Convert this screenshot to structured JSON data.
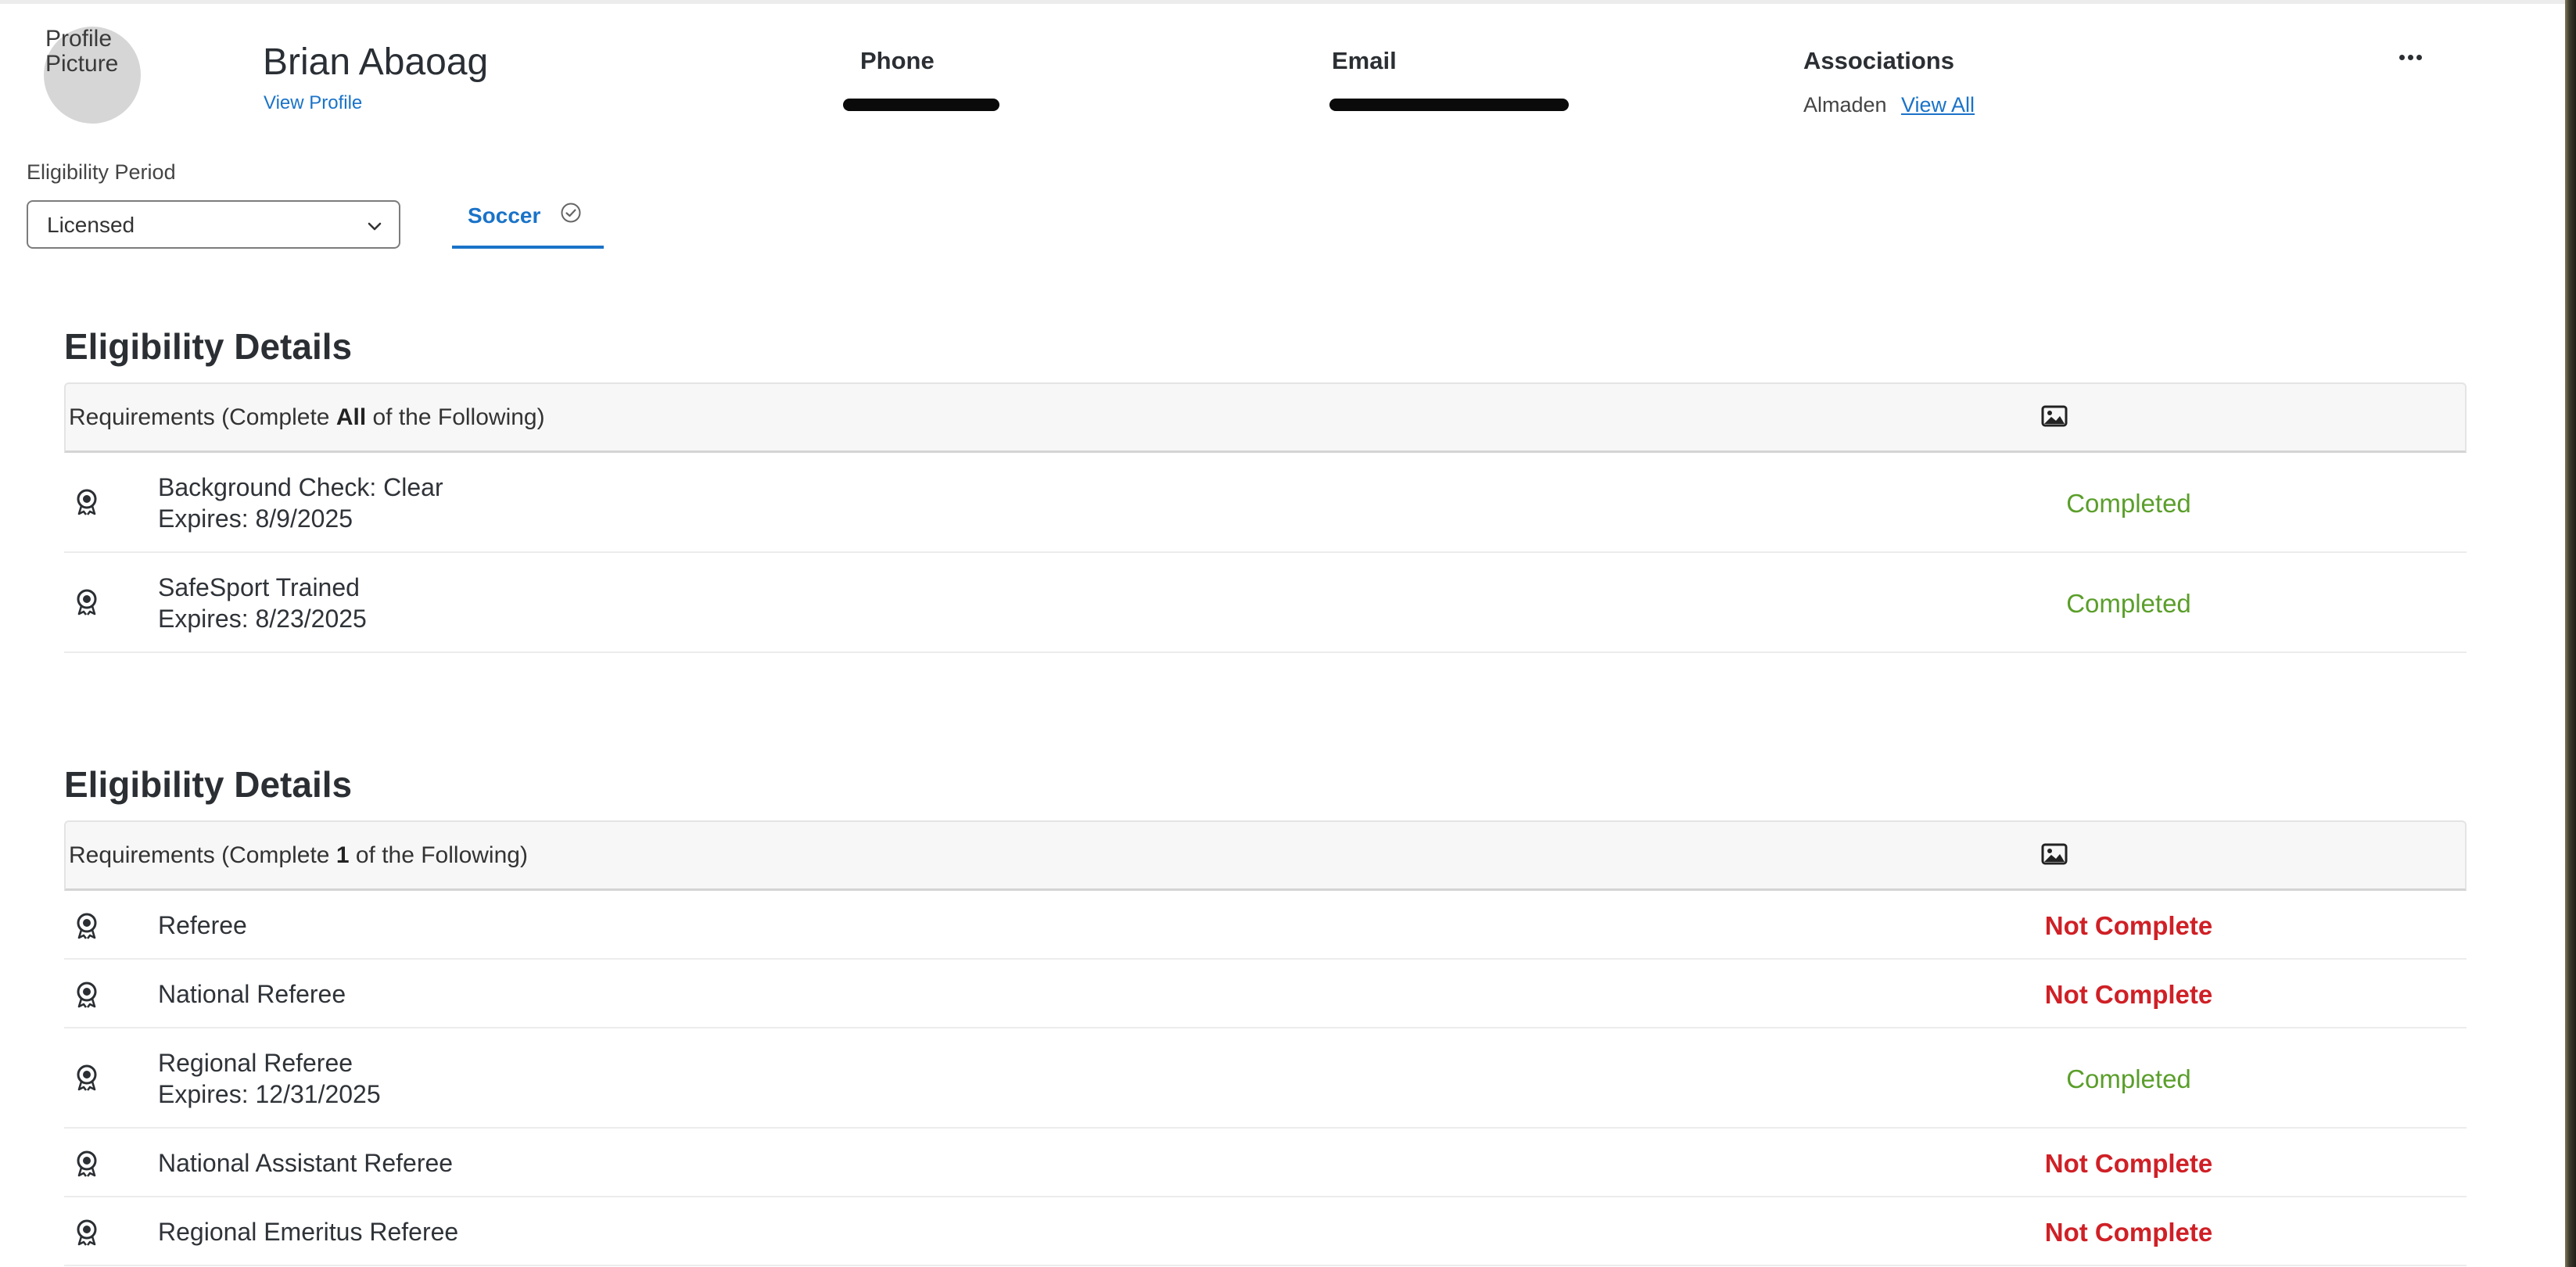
{
  "profile": {
    "avatar_text": "Profile Picture",
    "name": "Brian Abaoag",
    "view_profile": "View Profile"
  },
  "contact": {
    "phone_label": "Phone",
    "email_label": "Email",
    "associations_label": "Associations",
    "association_value": "Almaden",
    "associations_link": "View All"
  },
  "eligibility_period": {
    "label": "Eligibility Period",
    "selected": "Licensed"
  },
  "tab": {
    "label": "Soccer"
  },
  "sections": [
    {
      "title": "Eligibility Details",
      "requirements_prefix": "Requirements (Complete ",
      "requirements_count": "All",
      "requirements_suffix": " of the Following)",
      "rows": [
        {
          "title": "Background Check: Clear",
          "expires": "Expires: 8/9/2025",
          "status": "Completed"
        },
        {
          "title": "SafeSport Trained",
          "expires": "Expires: 8/23/2025",
          "status": "Completed"
        }
      ]
    },
    {
      "title": "Eligibility Details",
      "requirements_prefix": "Requirements (Complete ",
      "requirements_count": "1",
      "requirements_suffix": " of the Following)",
      "rows": [
        {
          "title": "Referee",
          "status": "Not Complete"
        },
        {
          "title": "National Referee",
          "status": "Not Complete"
        },
        {
          "title": "Regional Referee",
          "expires": "Expires: 12/31/2025",
          "status": "Completed"
        },
        {
          "title": "National Assistant Referee",
          "status": "Not Complete"
        },
        {
          "title": "Regional Emeritus Referee",
          "status": "Not Complete"
        }
      ]
    }
  ],
  "colors": {
    "link": "#1a73c8",
    "completed": "#5a9e2a",
    "not_complete": "#cf2026"
  }
}
